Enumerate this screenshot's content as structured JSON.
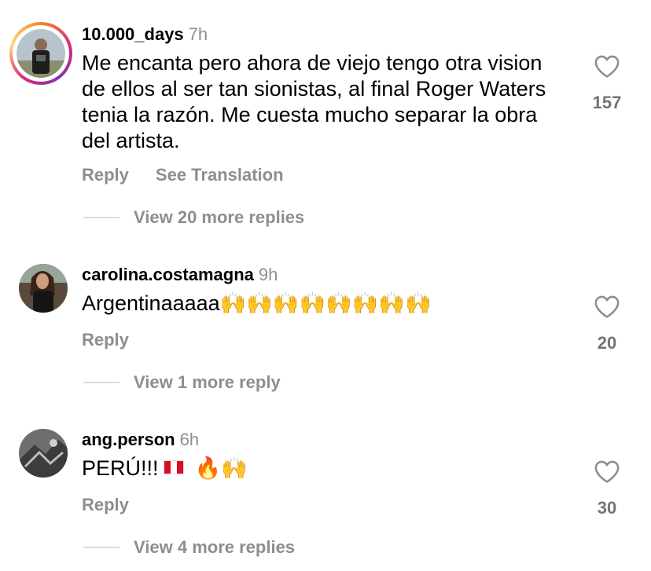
{
  "comments": [
    {
      "username": "10.000_days",
      "time": "7h",
      "text": "Me encanta pero ahora de viejo tengo otra vision de ellos al ser tan sionistas, al final Roger Waters tenia la razón. Me cuesta mucho separar la obra del artista.",
      "reply_label": "Reply",
      "translate_label": "See Translation",
      "likes": "157",
      "more_replies": "View 20 more replies",
      "avatar": "avatar-photo",
      "has_story_ring": true
    },
    {
      "username": "carolina.costamagna",
      "time": "9h",
      "text": "Argentinaaaaa🙌🙌🙌🙌🙌🙌🙌🙌",
      "reply_label": "Reply",
      "likes": "20",
      "more_replies": "View 1 more reply",
      "avatar": "avatar-photo"
    },
    {
      "username": "ang.person",
      "time": "6h",
      "text_prefix": "PERÚ!!!",
      "text_suffix": "🔥🙌",
      "flag": "peru-flag-icon",
      "reply_label": "Reply",
      "likes": "30",
      "more_replies": "View 4 more replies",
      "avatar": "avatar-photo"
    }
  ],
  "icons": {
    "like": "heart-outline-icon"
  },
  "colors": {
    "secondary_text": "#8e8e8e",
    "like_count": "#737373",
    "divider": "#dbdbdb"
  }
}
